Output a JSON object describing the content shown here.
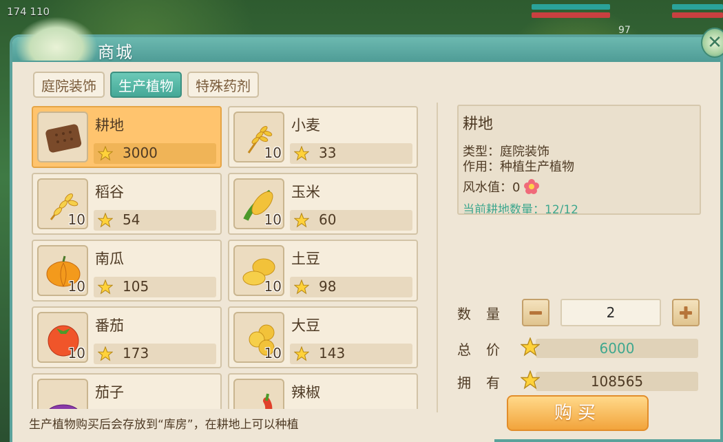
{
  "hud": {
    "coords": "174 110",
    "level": "97"
  },
  "dialog": {
    "title": "商城",
    "close_icon": "close-icon",
    "tabs": [
      {
        "label": "庭院装饰",
        "active": false
      },
      {
        "label": "生产植物",
        "active": true
      },
      {
        "label": "特殊药剂",
        "active": false
      }
    ],
    "items": [
      {
        "name": "耕地",
        "count": "",
        "price": "3000",
        "icon": "farmland-icon",
        "selected": true
      },
      {
        "name": "小麦",
        "count": "10",
        "price": "33",
        "icon": "wheat-icon",
        "selected": false
      },
      {
        "name": "稻谷",
        "count": "10",
        "price": "54",
        "icon": "rice-icon",
        "selected": false
      },
      {
        "name": "玉米",
        "count": "10",
        "price": "60",
        "icon": "corn-icon",
        "selected": false
      },
      {
        "name": "南瓜",
        "count": "10",
        "price": "105",
        "icon": "pumpkin-icon",
        "selected": false
      },
      {
        "name": "土豆",
        "count": "10",
        "price": "98",
        "icon": "potato-icon",
        "selected": false
      },
      {
        "name": "番茄",
        "count": "10",
        "price": "173",
        "icon": "tomato-icon",
        "selected": false
      },
      {
        "name": "大豆",
        "count": "10",
        "price": "143",
        "icon": "soybean-icon",
        "selected": false
      },
      {
        "name": "茄子",
        "count": "",
        "price": "",
        "icon": "eggplant-icon",
        "selected": false
      },
      {
        "name": "辣椒",
        "count": "",
        "price": "",
        "icon": "chili-icon",
        "selected": false
      }
    ],
    "detail": {
      "title": "耕地",
      "type_line": "类型：庭院装饰",
      "use_line": "作用：种植生产植物",
      "fengshui_line": "风水值：0",
      "extra_line": "当前耕地数量：12/12"
    },
    "purchase": {
      "qty_label": "数量",
      "qty_value": "2",
      "total_label": "总价",
      "total_value": "6000",
      "own_label": "拥有",
      "own_value": "108565",
      "buy_label": "购买"
    },
    "footer_note": "生产植物购买后会存放到“库房”，在耕地上可以种植"
  },
  "colors": {
    "accent_teal": "#4f9c96",
    "selected_item": "#ffc46e",
    "total_value": "#3ea78e",
    "buy_button": "#f2a43c"
  }
}
